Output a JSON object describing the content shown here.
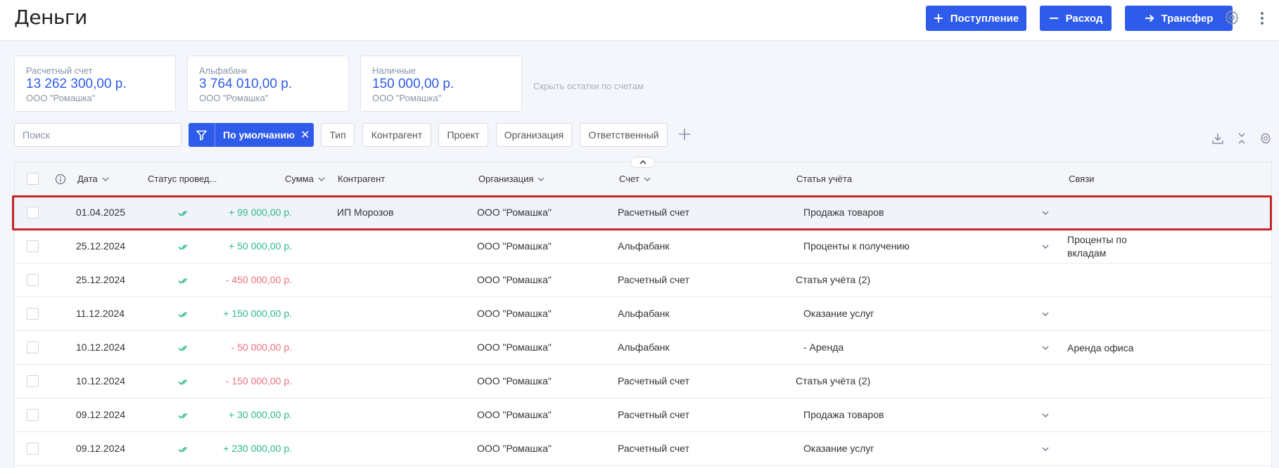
{
  "header": {
    "title": "Деньги",
    "income_label": "Поступление",
    "expense_label": "Расход",
    "transfer_label": "Трансфер"
  },
  "balances": [
    {
      "name": "Расчетный счет",
      "amount": "13 262 300,00 р.",
      "org": "ООО \"Ромашка\""
    },
    {
      "name": "Альфабанк",
      "amount": "3 764 010,00 р.",
      "org": "ООО \"Ромашка\""
    },
    {
      "name": "Наличные",
      "amount": "150 000,00 р.",
      "org": "ООО \"Ромашка\""
    }
  ],
  "hide_balances_label": "Скрыть остатки по счетам",
  "filters": {
    "search_placeholder": "Поиск",
    "active_preset": "По умолчанию",
    "chips": [
      "Тип",
      "Контрагент",
      "Проект",
      "Организация",
      "Ответственный"
    ]
  },
  "table": {
    "columns": {
      "date": "Дата",
      "status": "Статус провед...",
      "amount": "Сумма",
      "counterparty": "Контрагент",
      "org": "Организация",
      "account": "Счет",
      "article": "Статья учёта",
      "links": "Связи"
    },
    "rows": [
      {
        "date": "01.04.2025",
        "amount": "+ 99 000,00 р.",
        "sign": "pos",
        "counterparty": "ИП Морозов",
        "org": "ООО \"Ромашка\"",
        "account": "Расчетный счет",
        "article": "Продажа товаров",
        "article_dropdown": true,
        "links": ""
      },
      {
        "date": "25.12.2024",
        "amount": "+ 50 000,00 р.",
        "sign": "pos",
        "counterparty": "",
        "org": "ООО \"Ромашка\"",
        "account": "Альфабанк",
        "article": "Проценты к получению",
        "article_dropdown": true,
        "links": "Проценты по вкладам"
      },
      {
        "date": "25.12.2024",
        "amount": "- 450 000,00 р.",
        "sign": "neg",
        "counterparty": "",
        "org": "ООО \"Ромашка\"",
        "account": "Расчетный счет",
        "article": "Статья учёта (2)",
        "article_dropdown": false,
        "links": ""
      },
      {
        "date": "11.12.2024",
        "amount": "+ 150 000,00 р.",
        "sign": "pos",
        "counterparty": "",
        "org": "ООО \"Ромашка\"",
        "account": "Альфабанк",
        "article": "Оказание услуг",
        "article_dropdown": true,
        "links": ""
      },
      {
        "date": "10.12.2024",
        "amount": "- 50 000,00 р.",
        "sign": "neg",
        "counterparty": "",
        "org": "ООО \"Ромашка\"",
        "account": "Альфабанк",
        "article": "- Аренда",
        "article_dropdown": true,
        "links": "Аренда офиса"
      },
      {
        "date": "10.12.2024",
        "amount": "- 150 000,00 р.",
        "sign": "neg",
        "counterparty": "",
        "org": "ООО \"Ромашка\"",
        "account": "Расчетный счет",
        "article": "Статья учёта (2)",
        "article_dropdown": false,
        "links": ""
      },
      {
        "date": "09.12.2024",
        "amount": "+ 30 000,00 р.",
        "sign": "pos",
        "counterparty": "",
        "org": "ООО \"Ромашка\"",
        "account": "Расчетный счет",
        "article": "Продажа товаров",
        "article_dropdown": true,
        "links": ""
      },
      {
        "date": "09.12.2024",
        "amount": "+ 230 000,00 р.",
        "sign": "pos",
        "counterparty": "",
        "org": "ООО \"Ромашка\"",
        "account": "Расчетный счет",
        "article": "Оказание услуг",
        "article_dropdown": true,
        "links": ""
      }
    ]
  },
  "colors": {
    "accent": "#2f5bea",
    "positive": "#2dbd84",
    "negative": "#f06f7c",
    "selection_outline": "#c62828"
  },
  "icons": {
    "income": "plus-icon",
    "expense": "minus-icon",
    "transfer": "arrow-right-icon",
    "settings": "gear-icon",
    "more": "more-vertical-icon",
    "filter": "filter-icon",
    "clear": "close-icon",
    "add_filter": "plus-icon",
    "download": "download-icon",
    "collapse": "collapse-icon",
    "status": "double-check-icon"
  }
}
